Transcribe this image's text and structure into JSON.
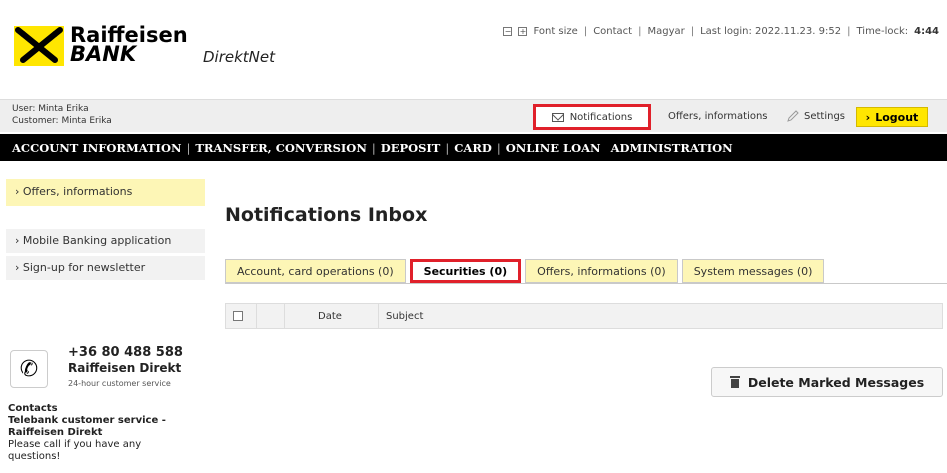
{
  "header": {
    "brand_line1": "Raiffeisen",
    "brand_line2": "BANK",
    "product": "DirektNet",
    "font_minus": "−",
    "font_plus": "+",
    "font_size": "Font size",
    "contact": "Contact",
    "language": "Magyar",
    "last_login": "Last login: 2022.11.23. 9:52",
    "timelock_label": "Time-lock:",
    "timelock_value": "4:44"
  },
  "userbar": {
    "user": "User: Minta Erika",
    "customer": "Customer: Minta Erika",
    "notifications": "Notifications",
    "offers": "Offers, informations",
    "settings": "Settings",
    "logout": "Logout"
  },
  "nav": {
    "items": [
      "ACCOUNT INFORMATION",
      "TRANSFER, CONVERSION",
      "DEPOSIT",
      "CARD",
      "ONLINE LOAN",
      "ADMINISTRATION"
    ]
  },
  "sidebar": {
    "active": "› Offers, informations",
    "items": [
      "› Mobile Banking application",
      "› Sign-up for newsletter"
    ],
    "phone": "+36 80 488 588",
    "phone_title": "Raiffeisen Direkt",
    "phone_sub": "24-hour customer service",
    "contacts_title": "Contacts",
    "contacts_line1": "Telebank customer service -",
    "contacts_line2": "Raiffeisen Direkt",
    "contacts_line3": "Please call if you have any",
    "contacts_line4": "questions!"
  },
  "main": {
    "title": "Notifications Inbox",
    "tabs": [
      "Account, card operations (0)",
      "Securities (0)",
      "Offers, informations (0)",
      "System messages (0)"
    ],
    "table": {
      "col_date": "Date",
      "col_subject": "Subject"
    },
    "delete_button": "Delete Marked Messages"
  },
  "colors": {
    "brand_yellow": "#ffe600",
    "highlight_red": "#e0202a",
    "nav_black": "#000000"
  }
}
